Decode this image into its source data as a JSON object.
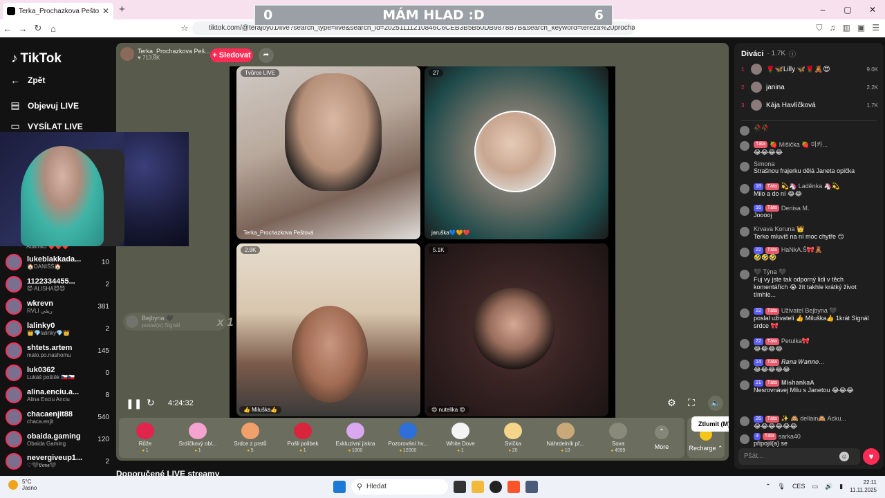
{
  "browser": {
    "tab_title": "Terka_Prochazkova Peštová (@",
    "url": "tiktok.com/@terajoy01/live?search_type=live&search_id=20251111210846C6CEB3B5B50DB9878B7B&search_keyword=tereza%20prochazkova",
    "new_tab": "+"
  },
  "overlay": {
    "left_score": "0",
    "title": "MÁM HLAD :D",
    "right_score": "6"
  },
  "sidebar": {
    "logo": "TikTok",
    "back": "Zpět",
    "explore": "Objevuj LIVE",
    "go_live": "VYSÍLAT LIVE",
    "partial_item": "Adamko ❤️❤️❤️",
    "items": [
      {
        "name": "lukeblakkada...",
        "sub": "🏠DANIŠŠ🏠",
        "count": "10"
      },
      {
        "name": "1122334455...",
        "sub": "😈 ALISHA😈😈",
        "count": "2"
      },
      {
        "name": "wkrevn",
        "sub": "RVLI ريفي",
        "count": "381"
      },
      {
        "name": "lalinky0",
        "sub": "👑💎lalinky💎👑",
        "count": "2"
      },
      {
        "name": "shtets.artem",
        "sub": "malo.po.nashomu",
        "count": "145"
      },
      {
        "name": "luk0362",
        "sub": "Lukáš poštěk 🇨🇿🇨🇿",
        "count": "0"
      },
      {
        "name": "alina.enciu.a...",
        "sub": "Alina Enciu Anciu",
        "count": "8"
      },
      {
        "name": "chacaenjit88",
        "sub": "chaca.enjit",
        "count": "540"
      },
      {
        "name": "obaida.gaming",
        "sub": "Obaida Gaming",
        "count": "120"
      },
      {
        "name": "nevergiveup1...",
        "sub": "♡🖤𝕷𝖊𝖓𝖆🖤",
        "count": "2"
      }
    ]
  },
  "live": {
    "host_name": "Terka_Prochazkova Peš...",
    "host_viewers": "713.8K",
    "follow": "+ Sledovat",
    "tiles": [
      {
        "badge": "Tvůrce LIVE",
        "name": "Terka_Prochazkova Peštová"
      },
      {
        "badge": "27",
        "name": "jaruška💙🧡❤️"
      },
      {
        "badge": "2.9K",
        "name": "👍 Miluška👍"
      },
      {
        "badge": "5.1K",
        "name": "😍 nutellka 😍"
      }
    ],
    "gift_note": {
      "name": "Bejbyna 🖤",
      "text": "poslal(a) Signál",
      "multiplier": "x 1"
    },
    "timer": "4:24:32",
    "tooltip": "Ztlumit (M)",
    "gifts": [
      {
        "name": "Růže",
        "price": "1",
        "color": "#e0244c"
      },
      {
        "name": "Srdíčkový obl...",
        "price": "1",
        "color": "#f4a3d0"
      },
      {
        "name": "Srdce z prstů",
        "price": "5",
        "color": "#f2a06b"
      },
      {
        "name": "Pošli polibek",
        "price": "1",
        "color": "#d8243c"
      },
      {
        "name": "Exkluzivní jiskra",
        "price": "1000",
        "color": "#d8a8f0"
      },
      {
        "name": "Pozorování hv...",
        "price": "12000",
        "color": "#2e6fd8"
      },
      {
        "name": "White Dove",
        "price": "1",
        "color": "#f4f4f4"
      },
      {
        "name": "Svíčka",
        "price": "20",
        "color": "#f5d58a"
      },
      {
        "name": "Náhrdelník př...",
        "price": "10",
        "color": "#c9a97a"
      },
      {
        "name": "Sova",
        "price": "4999",
        "color": "#8a8a7a"
      }
    ],
    "more": "More",
    "recharge": "Recharge ⌃"
  },
  "recommend_heading": "Doporučené LIVE streamy",
  "chat": {
    "title": "Diváci",
    "viewer_count": "· 1.7K",
    "top_viewers": [
      {
        "rank": "1",
        "name": "🌹🦋Lilly 🦋🌹🧸😍",
        "score": "9.0K"
      },
      {
        "rank": "2",
        "name": "janina",
        "score": "2.2K"
      },
      {
        "rank": "3",
        "name": "Kája Havlíčková",
        "score": "1.7K"
      }
    ],
    "messages": [
      {
        "badges": [],
        "user": "🥀🥀",
        "text": ""
      },
      {
        "badges": [
          "Táta"
        ],
        "user": "🍓 Mišička 🍓 미카...",
        "text": "😂😂😂😂"
      },
      {
        "badges": [],
        "user": "Simona",
        "text": "Strašnou frajerku dělá Janeta opička"
      },
      {
        "badges": [
          "18",
          "Táta"
        ],
        "user": "💫🦄 Laděnka 🦄💫",
        "text": "Milo a do ní 😂😂"
      },
      {
        "badges": [
          "16",
          "Táta"
        ],
        "user": "Denisa M.",
        "text": "Jooooj"
      },
      {
        "badges": [],
        "user": "Krvava Koruna 👑",
        "text": "Terko mluviš na ní moc chytře 😏"
      },
      {
        "badges": [
          "22",
          "Táta"
        ],
        "user": "HaNkA.Š🎀🧸",
        "text": "🤣🤣🤣"
      },
      {
        "badges": [],
        "user": "🖤 Týna 🖤",
        "text": "Fuj vy jste tak odporný lidi v těch komentářích 😭 žít takhle krátký život tímhle..."
      },
      {
        "badges": [
          "22",
          "Táta"
        ],
        "user": "Uživatel Bejbyna 🖤",
        "text": "poslal uživateli 👍 Miluška👍 1krát Signál srdce 🎀"
      },
      {
        "badges": [
          "22",
          "Táta"
        ],
        "user": "Petulka🎀",
        "text": "😂😂😂😂"
      },
      {
        "badges": [
          "14",
          "Táta"
        ],
        "user": "𝑹𝒂𝒏𝒂 𝑾𝒂𝒏𝒏𝒐...",
        "text": "😂😂😂😂😂"
      },
      {
        "badges": [
          "21",
          "Táta"
        ],
        "user": "𝐌𝐢𝐬𝐡𝐚𝐧𝐤𝐚𝐀",
        "text": "Nesrovnávej Milu s Janetou 😂😂😂"
      },
      {
        "badges": [
          "26",
          "Táta"
        ],
        "user": "✨ 🙈 dellain🙈 Acku...",
        "text": "😂😂😂😂😂😂"
      },
      {
        "badges": [
          "3",
          "Táta"
        ],
        "user": "sarka40",
        "text": "připojil(a) se"
      }
    ],
    "input_placeholder": "Pšát..."
  },
  "taskbar": {
    "temp": "5°C",
    "weather": "Jasno",
    "search": "Hledat",
    "lang": "CES",
    "time": "22:11",
    "date": "11.11.2025"
  }
}
